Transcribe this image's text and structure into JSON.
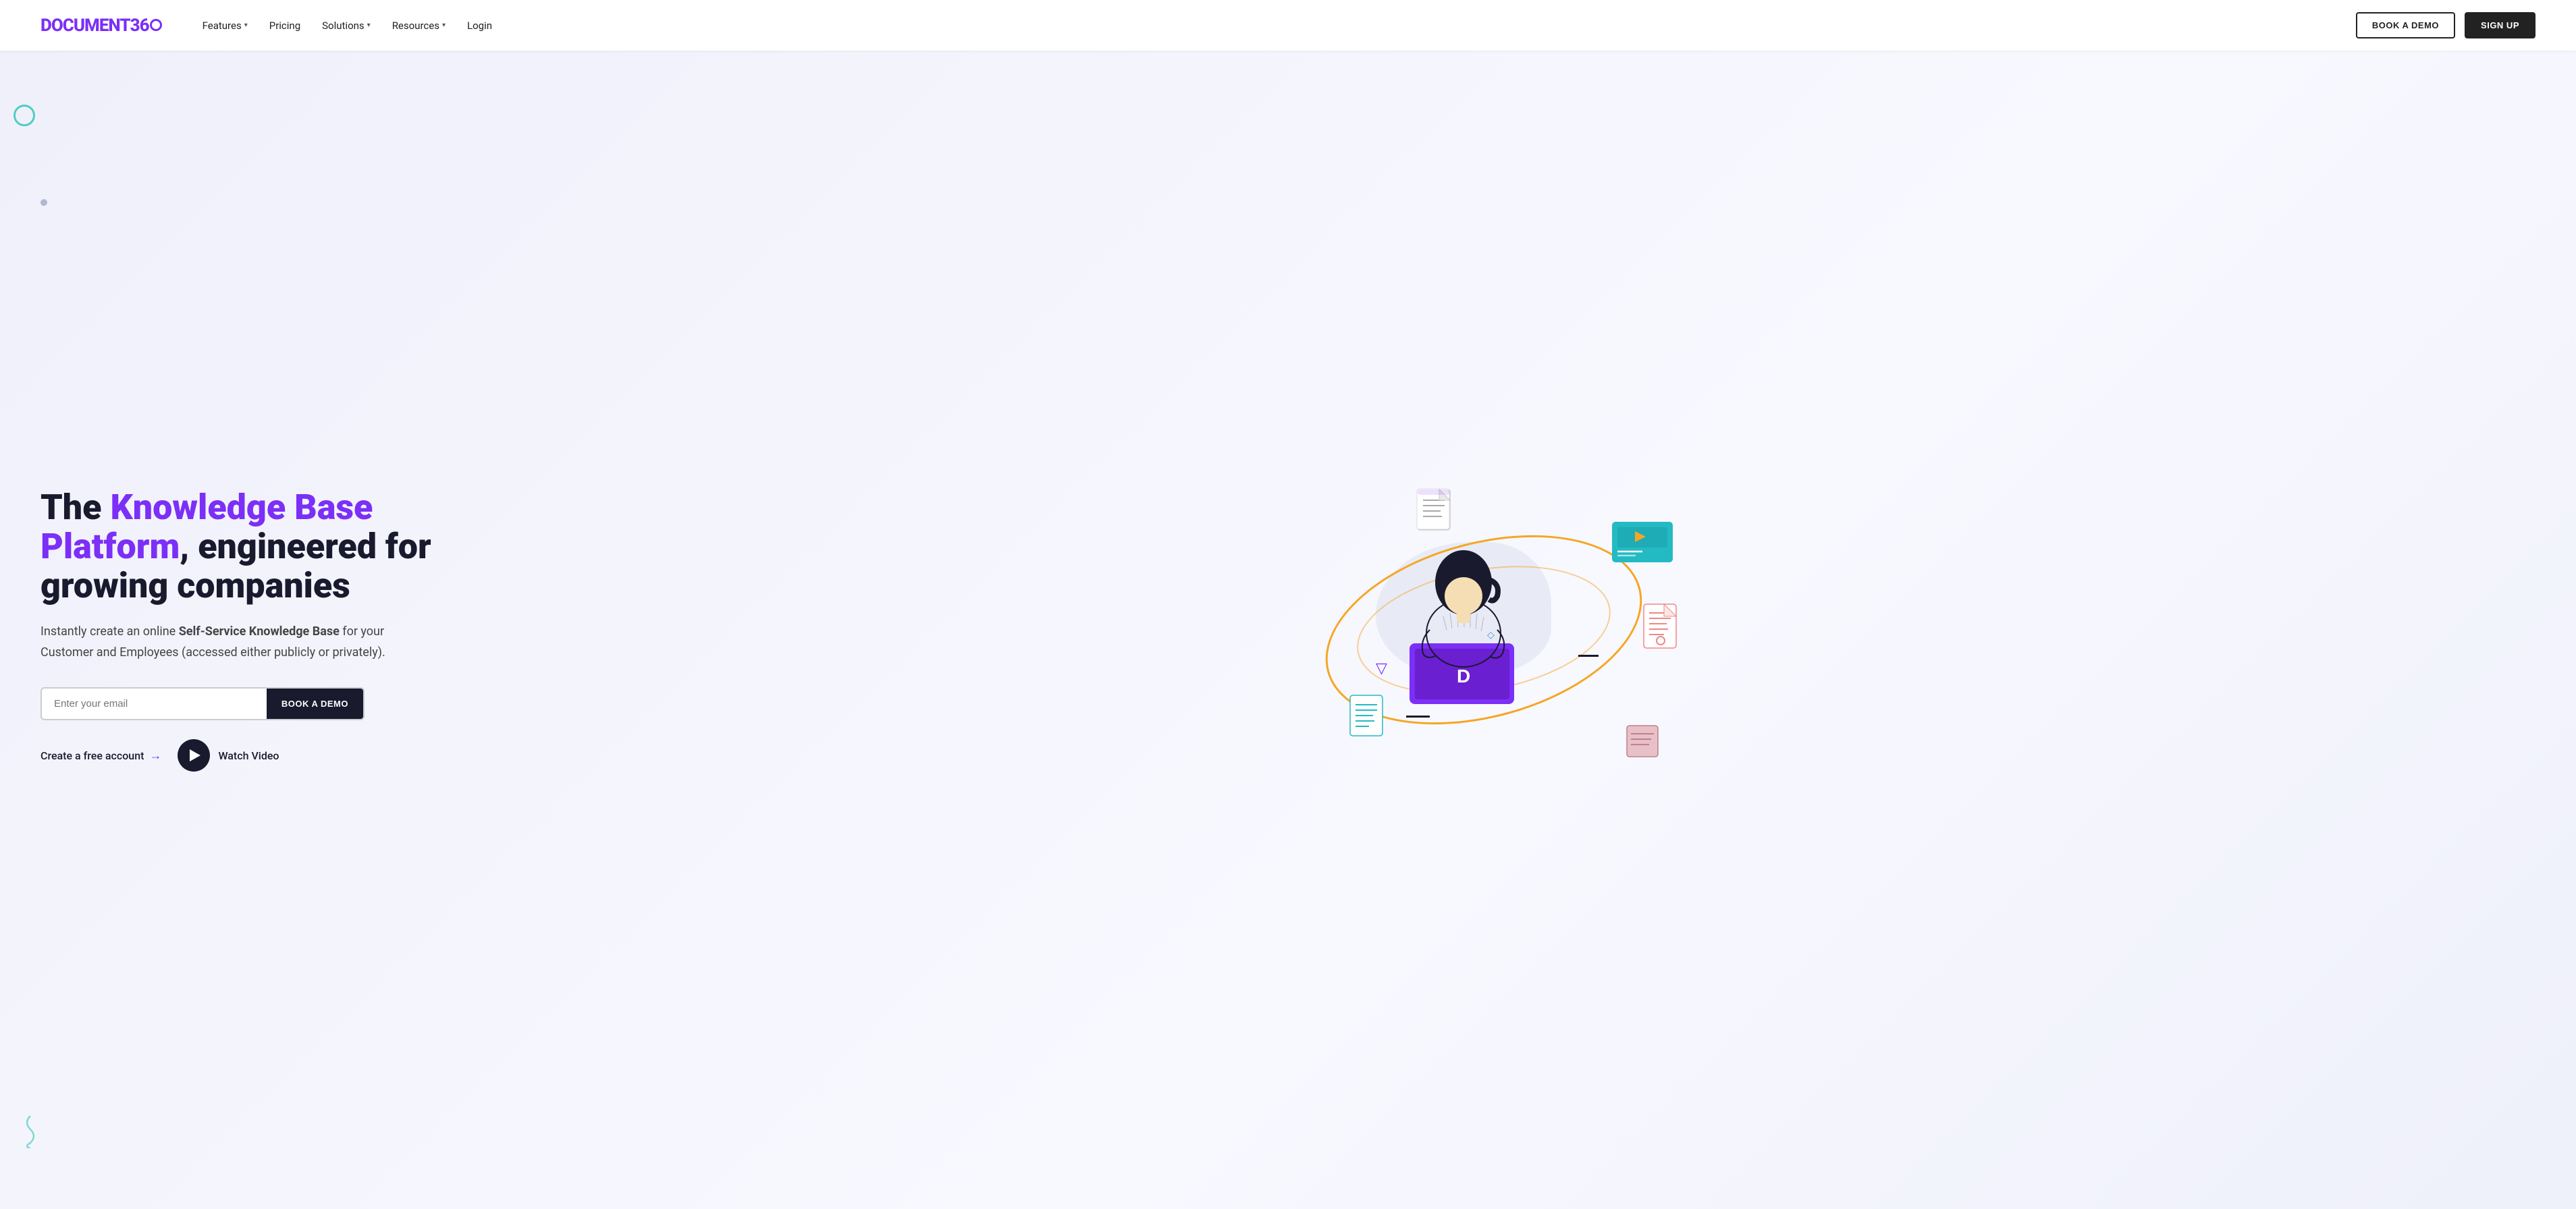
{
  "brand": {
    "name": "DOCUMENT",
    "suffix": "360",
    "logo_label": "Document360 logo"
  },
  "nav": {
    "links": [
      {
        "label": "Features",
        "has_dropdown": true
      },
      {
        "label": "Pricing",
        "has_dropdown": false
      },
      {
        "label": "Solutions",
        "has_dropdown": true
      },
      {
        "label": "Resources",
        "has_dropdown": true
      },
      {
        "label": "Login",
        "has_dropdown": false
      }
    ],
    "book_demo_label": "BOOK A DEMO",
    "signup_label": "SIGN UP"
  },
  "hero": {
    "title_prefix": "The ",
    "title_purple": "Knowledge Base Platform",
    "title_suffix": ", engineered for growing companies",
    "description_prefix": "Instantly create an online ",
    "description_bold": "Self-Service Knowledge Base",
    "description_suffix": " for your Customer and Employees (accessed either publicly or privately).",
    "email_placeholder": "Enter your email",
    "book_demo_inline_label": "BOOK A DEMO",
    "create_account_label": "Create a free account",
    "watch_video_label": "Watch Video"
  },
  "decorations": {
    "colors": {
      "purple": "#7b2ff7",
      "teal": "#4ecdc4",
      "orange": "#f5a623",
      "dark": "#1a1a2e",
      "pink": "#ff8fa3",
      "blue": "#4a90d9"
    }
  }
}
